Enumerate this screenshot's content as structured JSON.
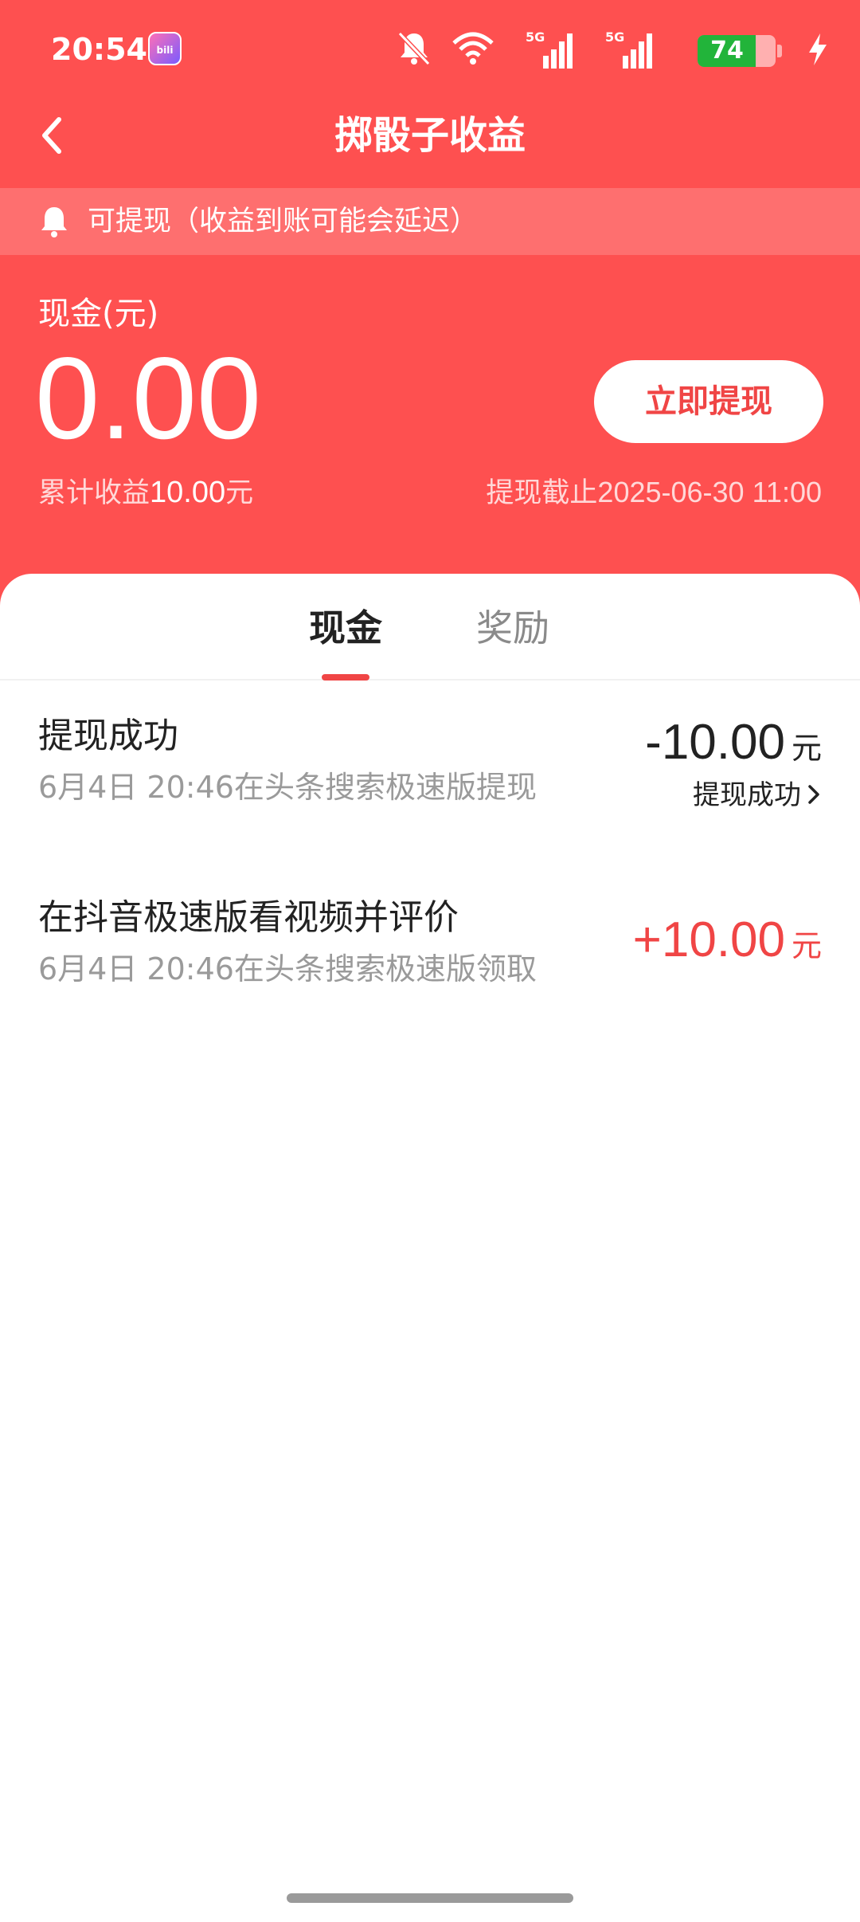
{
  "status_bar": {
    "time": "20:54",
    "battery_level": "74",
    "battery_fraction": 0.74,
    "network_labels": [
      "5G",
      "5G"
    ]
  },
  "header": {
    "title": "掷骰子收益",
    "back_icon": "chevron-left-icon"
  },
  "notice": {
    "icon": "bell-icon",
    "text": "可提现（收益到账可能会延迟）"
  },
  "balance": {
    "label": "现金(元)",
    "value": "0.00",
    "withdraw_label": "立即提现",
    "total_prefix": "累计收益",
    "total_value": "10.00",
    "total_suffix": "元",
    "deadline_prefix": "提现截止",
    "deadline_value": "2025-06-30 11:00"
  },
  "tabs": [
    {
      "label": "现金",
      "active": true
    },
    {
      "label": "奖励",
      "active": false
    }
  ],
  "records": [
    {
      "title": "提现成功",
      "subtitle": "6月4日 20:46在头条搜索极速版提现",
      "amount": "-10.00",
      "unit": "元",
      "status": "提现成功"
    },
    {
      "title": "在抖音极速版看视频并评价",
      "subtitle": "6月4日 20:46在头条搜索极速版领取",
      "amount": "+10.00",
      "unit": "元"
    }
  ],
  "colors": {
    "primary_red": "#fe5050",
    "accent_red": "#f04545",
    "battery_green": "#22b43a"
  }
}
